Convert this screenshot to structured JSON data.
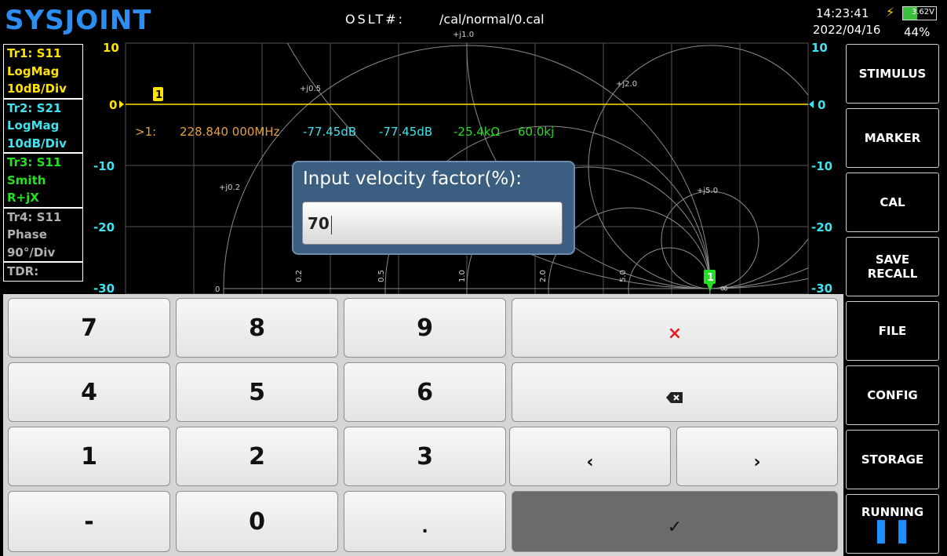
{
  "header": {
    "logo": "SYSJOINT",
    "cal_label": "OSLT#:",
    "cal_path": "/cal/normal/0.cal",
    "time": "14:23:41",
    "date": "2022/04/16",
    "battery_voltage": "3.62V",
    "battery_percent": "44%",
    "charging_icon": "lightning-icon"
  },
  "traces": [
    {
      "line1": "Tr1:  S11",
      "line2": "LogMag",
      "line3": "10dB/Div",
      "color": "#ffe300"
    },
    {
      "line1": "Tr2:  S21",
      "line2": "LogMag",
      "line3": "10dB/Div",
      "color": "#3fe2ee"
    },
    {
      "line1": "Tr3:  S11",
      "line2": "Smith",
      "line3": "R+jX",
      "color": "#22e022"
    },
    {
      "line1": "Tr4:  S11",
      "line2": "Phase",
      "line3": "90°/Div",
      "color": "#b0b0b0"
    },
    {
      "line1": "TDR:",
      "line2": "",
      "line3": ""
    }
  ],
  "plot": {
    "left_ticks": [
      "10",
      "0",
      "-10",
      "-20",
      "-30"
    ],
    "right_ticks": [
      "10",
      "0",
      "-10",
      "-20",
      "-30"
    ],
    "smith_labels": {
      "j1": "+j1.0",
      "j05": "+j0.5",
      "j2": "+j2.0",
      "j02": "+j0.2",
      "j5": "+j5.0",
      "r0": "0",
      "r02": "0.2",
      "r05": "0.5",
      "r1": "1.0",
      "r2": "2.0",
      "r5": "5.0",
      "inf": "∞"
    },
    "marker_label": "1"
  },
  "marker_readout": {
    "id": ">1:",
    "freq": "228.840 000MHz",
    "s11": "-77.45dB",
    "s21": "-77.45dB",
    "r": "-25.4kΩ",
    "x": "60.0kj"
  },
  "dialog": {
    "title": "Input velocity factor(%):",
    "value": "70"
  },
  "keypad": {
    "k7": "7",
    "k8": "8",
    "k9": "9",
    "clear": "×",
    "k4": "4",
    "k5": "5",
    "k6": "6",
    "backspace_icon": "backspace-icon",
    "k1": "1",
    "k2": "2",
    "k3": "3",
    "left": "‹",
    "right": "›",
    "minus": "-",
    "k0": "0",
    "dot": ".",
    "enter": "✓"
  },
  "side_menu": {
    "stimulus": "STIMULUS",
    "marker": "MARKER",
    "cal": "CAL",
    "save": "SAVE",
    "recall": "RECALL",
    "file": "FILE",
    "config": "CONFIG",
    "storage": "STORAGE",
    "running": "RUNNING",
    "pause_icon": "pause-icon"
  }
}
